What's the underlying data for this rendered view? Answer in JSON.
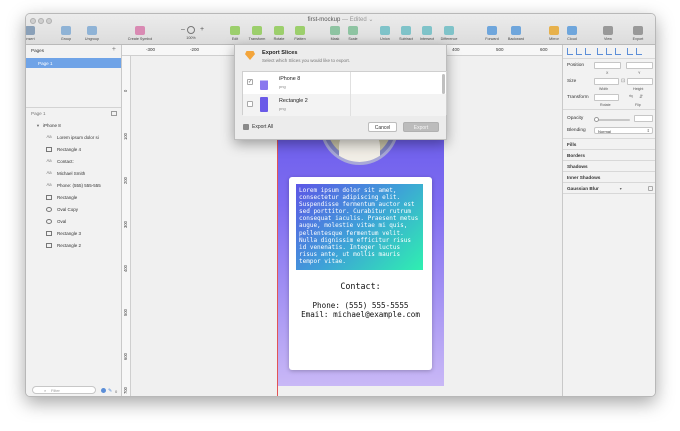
{
  "window": {
    "title": "first-mockup",
    "subtitle": "— Edited ⌄"
  },
  "toolbar": {
    "items": [
      {
        "label": "Insert",
        "color": "#8aa0b8"
      },
      {
        "label": "Group",
        "color": "#8fb3d6"
      },
      {
        "label": "Ungroup",
        "color": "#8fb3d6"
      },
      {
        "label": "Create Symbol",
        "color": "#d98ab3"
      },
      {
        "label": "100%",
        "color": "#777777"
      },
      {
        "label": "Edit",
        "color": "#9ccf6c"
      },
      {
        "label": "Transform",
        "color": "#9ccf6c"
      },
      {
        "label": "Rotate",
        "color": "#9ccf6c"
      },
      {
        "label": "Flatten",
        "color": "#9ccf6c"
      },
      {
        "label": "Mask",
        "color": "#8ec4a2"
      },
      {
        "label": "Scale",
        "color": "#8ec4a2"
      },
      {
        "label": "Union",
        "color": "#7fc3c9"
      },
      {
        "label": "Subtract",
        "color": "#7fc3c9"
      },
      {
        "label": "Intersect",
        "color": "#7fc3c9"
      },
      {
        "label": "Difference",
        "color": "#7fc3c9"
      },
      {
        "label": "Forward",
        "color": "#6fa6dc"
      },
      {
        "label": "Backward",
        "color": "#6fa6dc"
      },
      {
        "label": "Mirror",
        "color": "#e7b14c"
      },
      {
        "label": "Cloud",
        "color": "#6fa6dc"
      },
      {
        "label": "View",
        "color": "#999999"
      },
      {
        "label": "Export",
        "color": "#999999"
      }
    ],
    "zoom_minus": "–",
    "zoom_plus": "+"
  },
  "pages_panel": {
    "heading": "Pages",
    "add": "+",
    "pages": [
      "Page 1"
    ]
  },
  "layers_panel": {
    "page_label": "Page 1",
    "artboard": "iPhone 8",
    "layers": [
      {
        "type": "Aa",
        "name": "Lorem ipsum dolor si"
      },
      {
        "type": "▭",
        "name": "Rectangle 4"
      },
      {
        "type": "Aa",
        "name": "Contact:"
      },
      {
        "type": "Aa",
        "name": "Michael Smith"
      },
      {
        "type": "Aa",
        "name": "Phone: (555) 555-555"
      },
      {
        "type": "▭",
        "name": "Rectangle"
      },
      {
        "type": "◯",
        "name": "Oval Copy"
      },
      {
        "type": "◯",
        "name": "Oval"
      },
      {
        "type": "▭",
        "name": "Rectangle 3"
      },
      {
        "type": "▭",
        "name": "Rectangle 2"
      }
    ],
    "filter_placeholder": "Filter",
    "filter_count": "0"
  },
  "rulers": {
    "top": [
      "-300",
      "-200",
      "400",
      "500",
      "600"
    ],
    "left": [
      "0",
      "100",
      "200",
      "300",
      "400",
      "500",
      "600",
      "700"
    ]
  },
  "artboard": {
    "lorem": "Lorem ipsum dolor sit amet, consectetur adipiscing elit. Suspendisse fermentum auctor est sed porttitor. Curabitur rutrum consequat iaculis. Praesent metus augue, molestie vitae mi quis, pellentesque fermentum velit. Nulla dignissim efficitur risus id venenatis. Integer luctus risus ante, ut mollis mauris tempor vitae.",
    "contact_heading": "Contact:",
    "phone": "Phone: (555) 555-5555",
    "email": "Email: michael@example.com"
  },
  "export_dialog": {
    "title": "Export Slices",
    "subtitle": "Select which Slices you would like to export.",
    "slices": [
      {
        "name": "iPhone 8",
        "format": "png",
        "checked": "✓",
        "thumb": "#8a78ee"
      },
      {
        "name": "Rectangle 2",
        "format": "png",
        "checked": "",
        "thumb": "#6a5ae8"
      }
    ],
    "export_all_label": "Export All",
    "cancel_label": "Cancel",
    "export_label": "Export"
  },
  "inspector": {
    "position_label": "Position",
    "x_label": "X",
    "y_label": "Y",
    "size_label": "Size",
    "width_label": "Width",
    "height_label": "Height",
    "transform_label": "Transform",
    "rotate_label": "Rotate",
    "flip_label": "Flip",
    "opacity_label": "Opacity",
    "blending_label": "Blending",
    "blending_value": "Normal",
    "sections": [
      "Fills",
      "Borders",
      "Shadows",
      "Inner Shadows",
      "Gaussian Blur"
    ]
  }
}
